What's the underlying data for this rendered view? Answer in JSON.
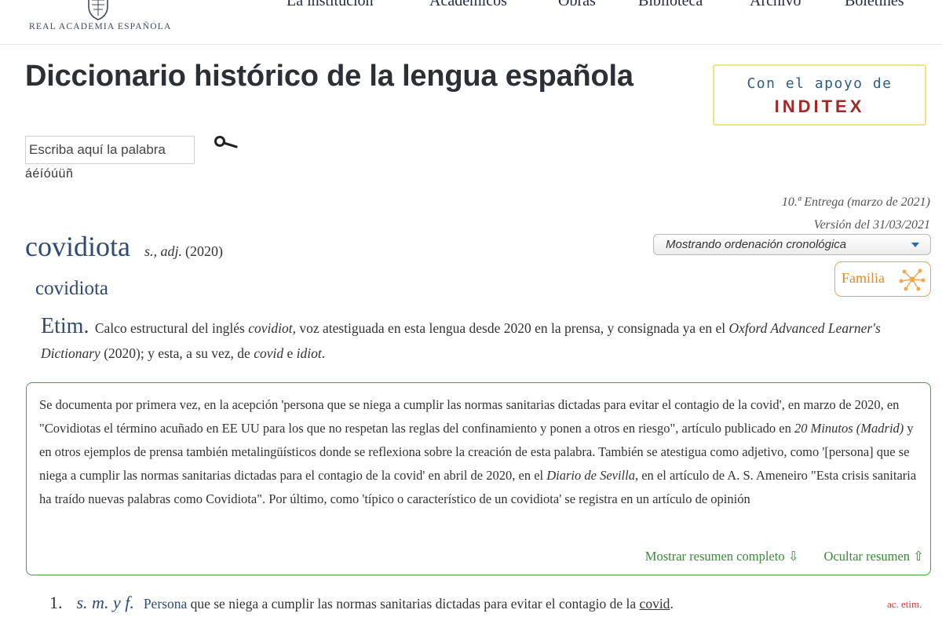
{
  "header": {
    "logo_text": "REAL ACADEMIA ESPAÑOLA",
    "nav": [
      {
        "label": "La institución"
      },
      {
        "label": "Académicos"
      },
      {
        "label": "Obras"
      },
      {
        "label": "Biblioteca"
      },
      {
        "label": "Archivo"
      },
      {
        "label": "Boletines"
      }
    ]
  },
  "page_title": "Diccionario histórico de la lengua española",
  "sponsor": {
    "label": "Con el apoyo de",
    "brand": "INDITEX",
    "border_color": "#f3e083",
    "brand_color": "#a02a2a"
  },
  "search": {
    "placeholder": "Escriba aquí la palabra",
    "icon": "search-icon",
    "accents": "áéíóúüñ"
  },
  "edition": {
    "delivery": "10.ª Entrega (marzo de 2021)",
    "version": "Versión del 31/03/2021"
  },
  "ordering": {
    "selected": "Mostrando ordenación cronológica"
  },
  "family_button": {
    "label": "Familia",
    "icon": "family-network-icon",
    "color": "#e08a2c"
  },
  "entry": {
    "headword": "covidiota",
    "grammar": "s., adj.",
    "year": "(2020)",
    "variant": "covidiota"
  },
  "etymology": {
    "label": "Etim.",
    "text_1": " Calco estructural del inglés ",
    "term_1": "covidiot",
    "text_2": ", voz atestiguada en esta lengua desde 2020 en la prensa, y consignada ya en el ",
    "term_2": "Oxford Advanced Learner's Dictionary",
    "text_3": " (2020); y esta, a su vez, de ",
    "term_3": "covid",
    "text_4": " e ",
    "term_4": "idiot",
    "text_5": "."
  },
  "summary": {
    "part_1": "Se documenta por primera vez, en la acepción 'persona que se niega a cumplir las normas sanitarias dictadas para evitar el contagio de la covid', en marzo de 2020, en \"Covidiotas el término acuñado en EE UU para los que no respetan las reglas del confinamiento y ponen a otros en riesgo\", artículo publicado en ",
    "source_1": "20 Minutos (Madrid)",
    "part_2": " y en otros ejemplos de prensa también metalingüísticos donde se reflexiona sobre la creación de esta palabra. También se atestigua como adjetivo, como '[persona] que se niega a cumplir las normas sanitarias dictadas para el contagio de la covid' en abril de 2020, en el ",
    "source_2": "Diario de Sevilla",
    "part_3": ", en el artículo de A. S. Ameneiro \"Esta crisis sanitaria ha traído nuevas palabras como Covidiota\". Por último, como 'típico o característico de un covidiota' se registra en un artículo de opinión",
    "show_full": "Mostrar resumen completo ⇩",
    "hide": "Ocultar resumen ⇧",
    "border_color": "#4c9a4c"
  },
  "sense": {
    "number": "1.",
    "grammar": "s. m. y f.",
    "def_link": "Persona",
    "def_text": " que se niega a cumplir las normas sanitarias dictadas para evitar el contagio de la ",
    "def_term": "covid",
    "def_end": ".",
    "ac_etim": "ac. etim."
  }
}
